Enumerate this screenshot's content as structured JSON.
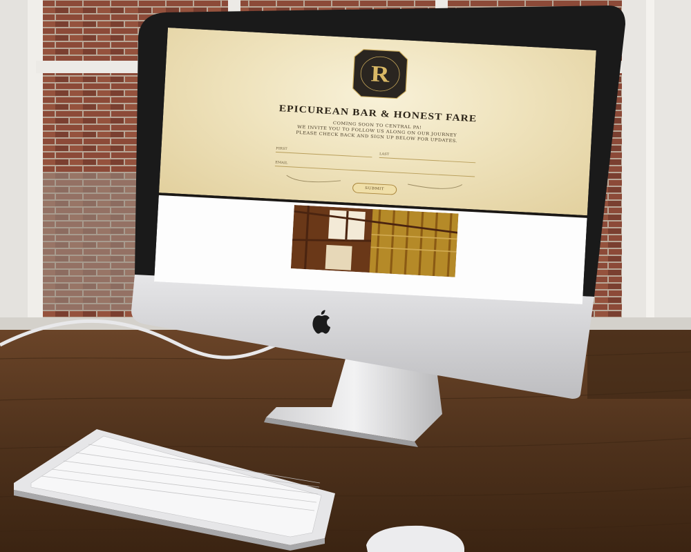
{
  "site": {
    "title": "EPICUREAN BAR & HONEST FARE",
    "logo_letter": "R",
    "tagline": [
      "COMING SOON TO CENTRAL PA!",
      "WE INVITE YOU TO FOLLOW US ALONG ON OUR JOURNEY",
      "PLEASE CHECK BACK AND SIGN UP BELOW FOR UPDATES."
    ],
    "form": {
      "first_label": "FIRST",
      "last_label": "LAST",
      "email_label": "EMAIL",
      "submit_label": "SUBMIT"
    }
  },
  "colors": {
    "cream": "#efe3bd",
    "badge": "#2a2520",
    "gold": "#d9b865",
    "wood_desk": "#5a3a22",
    "brick": "#8a4a35"
  },
  "icons": [
    "apple-logo-icon"
  ]
}
